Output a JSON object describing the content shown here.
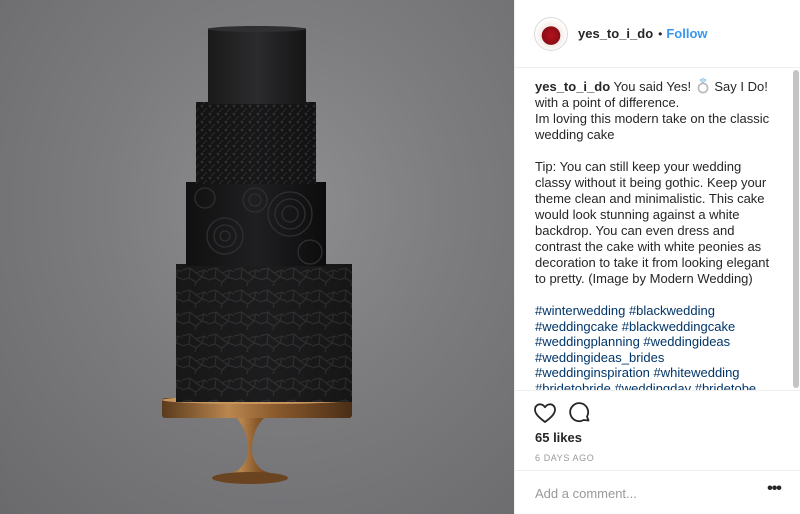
{
  "post": {
    "image_alt": "Four-tier black wedding cake on a copper cake stand",
    "icons": {
      "photo": "wedding-cake-photo",
      "avatar": "profile-avatar",
      "ring": "ring-emoji-icon",
      "like": "heart-icon",
      "comment": "comment-bubble-icon",
      "more": "more-options-icon"
    },
    "colors": {
      "follow": "#3897f0",
      "hashtag": "#003569",
      "muted": "#999999",
      "text": "#262626"
    }
  },
  "header": {
    "username": "yes_to_i_do",
    "separator": "•",
    "follow_label": "Follow"
  },
  "caption": {
    "username": "yes_to_i_do",
    "text_before_emoji": "You said Yes! ",
    "text_after_emoji": " Say I Do! with a point of difference.\nIm loving this modern take on the classic wedding cake\n\nTip: You can still keep your wedding classy without it being gothic. Keep your theme clean and minimalistic. This cake would look stunning against a white backdrop. You can even dress and contrast the cake with white peonies as decoration to take it from looking elegant to pretty. (Image by Modern Wedding)",
    "hashtags": "#winterwedding #blackwedding #weddingcake #blackweddingcake #weddingplanning #weddingideas #weddingideas_brides #weddinginspiration #whitewedding #bridetobride #weddingday #bridetobe #rusticwedding #classicwedding"
  },
  "engagement": {
    "likes": "65 likes",
    "timestamp": "6 DAYS AGO"
  },
  "comment_box": {
    "placeholder": "Add a comment...",
    "value": ""
  },
  "more_label": "•••"
}
